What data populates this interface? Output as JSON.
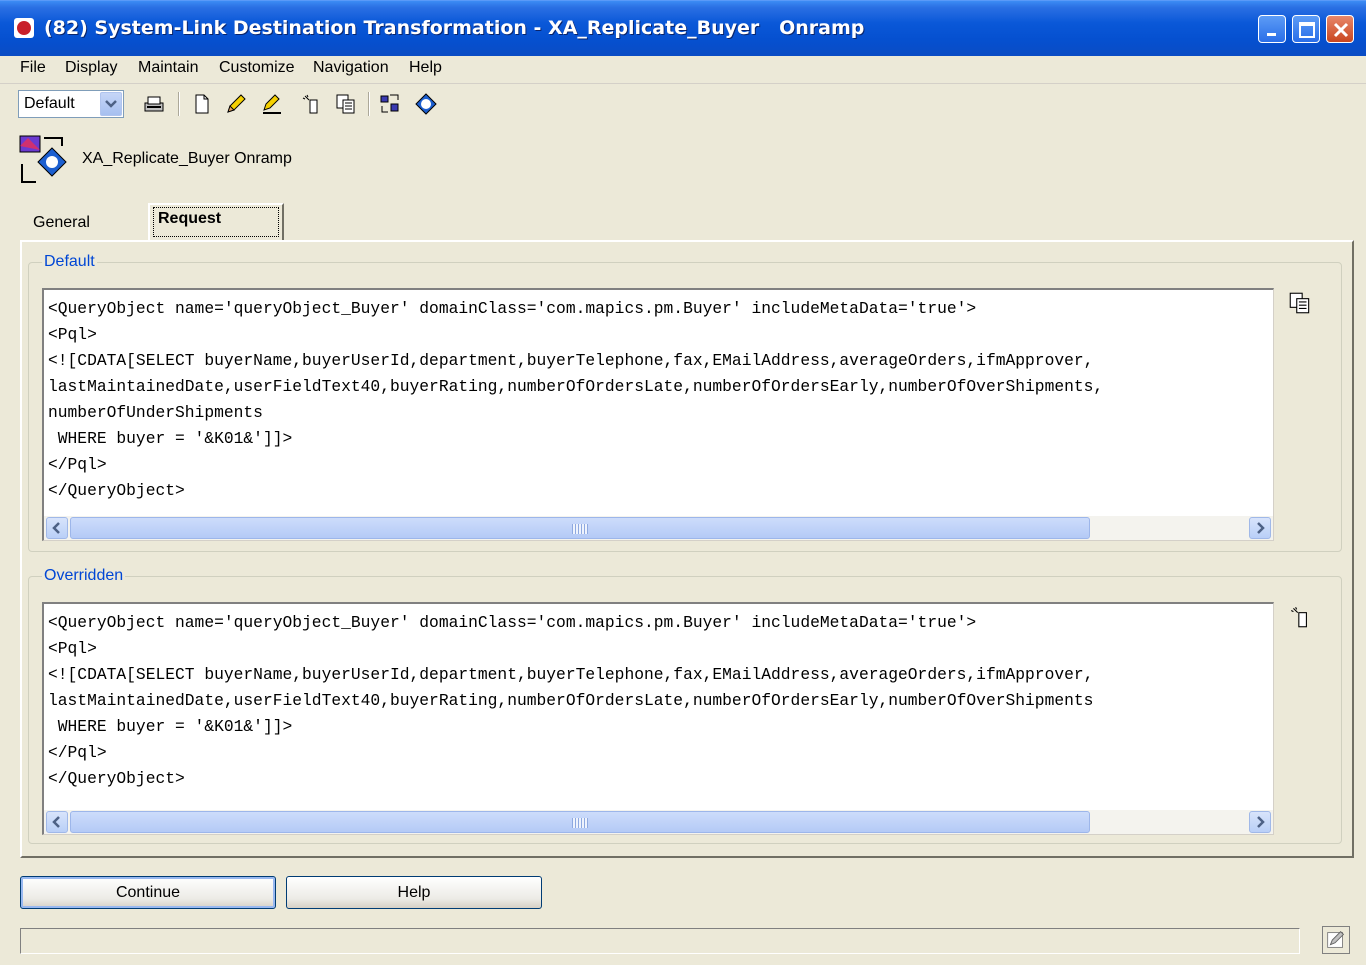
{
  "window": {
    "title": "(82) System-Link Destination Transformation - XA_Replicate_Buyer   Onramp"
  },
  "menu": [
    "File",
    "Display",
    "Maintain",
    "Customize",
    "Navigation",
    "Help"
  ],
  "toolbar": {
    "view_select": "Default",
    "icons": [
      "print-icon",
      "new-icon",
      "edit-icon",
      "rename-icon",
      "override-icon",
      "copy-icon",
      "transform-icon",
      "xml-icon"
    ]
  },
  "header": {
    "label": "XA_Replicate_Buyer  Onramp"
  },
  "tabs": [
    {
      "label": "General"
    },
    {
      "label": "Request"
    }
  ],
  "default_group": {
    "legend": "Default",
    "text": "<QueryObject name='queryObject_Buyer' domainClass='com.mapics.pm.Buyer' includeMetaData='true'>\n<Pql>\n<![CDATA[SELECT buyerName,buyerUserId,department,buyerTelephone,fax,EMailAddress,averageOrders,ifmApprover,\nlastMaintainedDate,userFieldText40,buyerRating,numberOfOrdersLate,numberOfOrdersEarly,numberOfOverShipments,\nnumberOfUnderShipments\n WHERE buyer = '&K01&']]>\n</Pql>\n</QueryObject>",
    "side_icon": "copy-icon"
  },
  "overridden_group": {
    "legend": "Overridden",
    "text": "<QueryObject name='queryObject_Buyer' domainClass='com.mapics.pm.Buyer' includeMetaData='true'>\n<Pql>\n<![CDATA[SELECT buyerName,buyerUserId,department,buyerTelephone,fax,EMailAddress,averageOrders,ifmApprover,\nlastMaintainedDate,userFieldText40,buyerRating,numberOfOrdersLate,numberOfOrdersEarly,numberOfOverShipments\n WHERE buyer = '&K01&']]>\n</Pql>\n</QueryObject>",
    "side_icon": "override-icon"
  },
  "buttons": {
    "continue": "Continue",
    "help": "Help"
  },
  "colors": {
    "titlebar": "#0a58d8",
    "face": "#ece9d8",
    "legend": "#0046d5"
  }
}
